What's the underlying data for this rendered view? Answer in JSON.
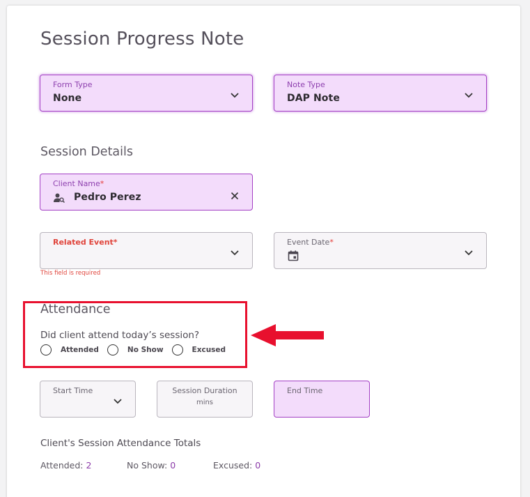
{
  "page_title": "Session Progress Note",
  "form_type": {
    "label": "Form Type",
    "value": "None"
  },
  "note_type": {
    "label": "Note Type",
    "value": "DAP Note"
  },
  "session_details": {
    "title": "Session Details",
    "client_name": {
      "label": "Client Name",
      "required_mark": "*",
      "value": "Pedro Perez"
    },
    "related_event": {
      "label": "Related Event",
      "required_mark": "*",
      "value": "",
      "helper": "This field is required"
    },
    "event_date": {
      "label": "Event Date",
      "required_mark": "*",
      "value": ""
    }
  },
  "attendance": {
    "title": "Attendance",
    "question": "Did client attend today’s session?",
    "options": [
      "Attended",
      "No Show",
      "Excused"
    ]
  },
  "times": {
    "start_time": {
      "label": "Start Time"
    },
    "session_duration": {
      "label": "Session Duration",
      "unit": "mins"
    },
    "end_time": {
      "label": "End Time"
    }
  },
  "totals": {
    "title": "Client's Session Attendance Totals",
    "attended": {
      "label": "Attended:",
      "value": "2"
    },
    "no_show": {
      "label": "No Show:",
      "value": "0"
    },
    "excused": {
      "label": "Excused:",
      "value": "0"
    }
  },
  "colors": {
    "accent_purple": "#a33fc4",
    "field_purple_bg": "#f3dcfb",
    "error_red": "#e0443b",
    "highlight_red": "#e8102e"
  },
  "icons": {
    "dropdown": "chevron-down-icon",
    "clear": "close-icon",
    "client": "person-search-icon",
    "date": "calendar-icon",
    "annotation": "arrow-left-icon"
  }
}
